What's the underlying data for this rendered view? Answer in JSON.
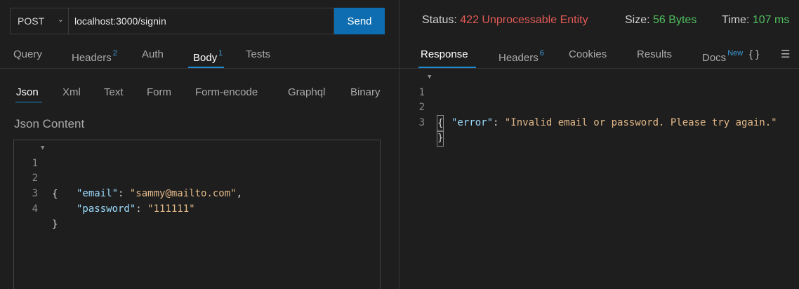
{
  "request": {
    "method": "POST",
    "url": "localhost:3000/signin",
    "send_label": "Send"
  },
  "request_tabs": [
    {
      "label": "Query",
      "badge": ""
    },
    {
      "label": "Headers",
      "badge": "2"
    },
    {
      "label": "Auth",
      "badge": ""
    },
    {
      "label": "Body",
      "badge": "1"
    },
    {
      "label": "Tests",
      "badge": ""
    }
  ],
  "body_tabs": [
    "Json",
    "Xml",
    "Text",
    "Form",
    "Form-encode",
    "Graphql",
    "Binary"
  ],
  "body_section_label": "Json Content",
  "editor": {
    "lines": [
      {
        "num": "1",
        "text": "{"
      },
      {
        "num": "2",
        "key": "\"email\"",
        "value": "\"sammy@mailto.com\"",
        "trail": ","
      },
      {
        "num": "3",
        "key": "\"password\"",
        "value": "\"111111\"",
        "trail": ""
      },
      {
        "num": "4",
        "text": "}"
      }
    ]
  },
  "status": {
    "status_label": "Status:",
    "status_value": "422 Unprocessable Entity",
    "size_label": "Size:",
    "size_value": "56 Bytes",
    "time_label": "Time:",
    "time_value": "107 ms"
  },
  "response_tabs": [
    {
      "label": "Response",
      "badge": ""
    },
    {
      "label": "Headers",
      "badge": "6"
    },
    {
      "label": "Cookies",
      "badge": ""
    },
    {
      "label": "Results",
      "badge": ""
    },
    {
      "label": "Docs",
      "badge": "New"
    }
  ],
  "response": {
    "lines": [
      {
        "num": "1",
        "text": "{"
      },
      {
        "num": "2",
        "key": "\"error\"",
        "value": "\"Invalid email or password. Please try again.\""
      },
      {
        "num": "3",
        "text": "}"
      }
    ]
  },
  "icons": {
    "braces": "{ }",
    "menu": "☰"
  },
  "colors": {
    "accent": "#0e6db0",
    "status_error": "#e05a55",
    "status_ok": "#4fbf5e"
  }
}
